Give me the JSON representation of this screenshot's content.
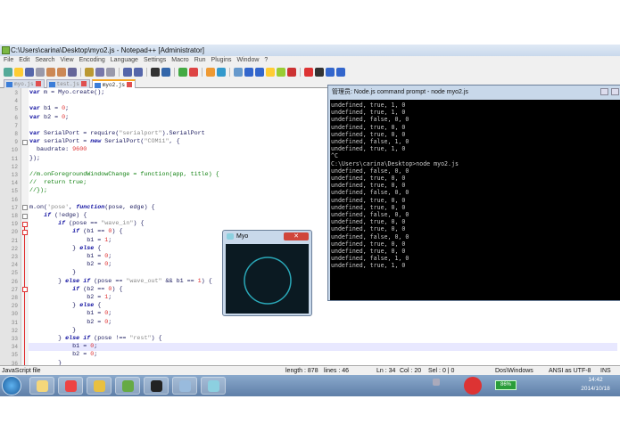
{
  "window_title": "C:\\Users\\carina\\Desktop\\myo2.js - Notepad++ [Administrator]",
  "menu": [
    "File",
    "Edit",
    "Search",
    "View",
    "Encoding",
    "Language",
    "Settings",
    "Macro",
    "Run",
    "Plugins",
    "Window",
    "?"
  ],
  "tabs": [
    {
      "label": "myo.js"
    },
    {
      "label": "test.js"
    },
    {
      "label": "myo2.js",
      "active": true
    }
  ],
  "editor": {
    "first_line": 3,
    "current_line": 34,
    "lines": [
      [
        [
          "kb",
          "var"
        ],
        [
          "t",
          " m = Myo.create();"
        ]
      ],
      [],
      [
        [
          "kb",
          "var"
        ],
        [
          "t",
          " b1 = "
        ],
        [
          "n",
          "0"
        ],
        [
          "t",
          ";"
        ]
      ],
      [
        [
          "kb",
          "var"
        ],
        [
          "t",
          " b2 = "
        ],
        [
          "n",
          "0"
        ],
        [
          "t",
          ";"
        ]
      ],
      [],
      [
        [
          "kb",
          "var"
        ],
        [
          "t",
          " SerialPort = require("
        ],
        [
          "s",
          "\"serialport\""
        ],
        [
          "t",
          ").SerialPort"
        ]
      ],
      [
        [
          "kb",
          "var"
        ],
        [
          "t",
          " serialPort = "
        ],
        [
          "k",
          "new"
        ],
        [
          "t",
          " SerialPort("
        ],
        [
          "s",
          "\"COM11\""
        ],
        [
          "t",
          ", {"
        ]
      ],
      [
        [
          "t",
          "  baudrate: "
        ],
        [
          "n",
          "9600"
        ]
      ],
      [
        [
          "t",
          "});"
        ]
      ],
      [],
      [
        [
          "c",
          "//m.onForegroundWindowChange = function(app, title) {"
        ]
      ],
      [
        [
          "c",
          "//  return true;"
        ]
      ],
      [
        [
          "c",
          "//});"
        ]
      ],
      [],
      [
        [
          "t",
          "m.on("
        ],
        [
          "s",
          "'pose'"
        ],
        [
          "t",
          ", "
        ],
        [
          "k",
          "function"
        ],
        [
          "t",
          "(pose, edge) {"
        ]
      ],
      [
        [
          "t",
          "    "
        ],
        [
          "k",
          "if"
        ],
        [
          "t",
          " (!edge) {"
        ]
      ],
      [
        [
          "t",
          "        "
        ],
        [
          "k",
          "if"
        ],
        [
          "t",
          " (pose == "
        ],
        [
          "s",
          "\"wave_in\""
        ],
        [
          "t",
          ") {"
        ]
      ],
      [
        [
          "t",
          "            "
        ],
        [
          "k",
          "if"
        ],
        [
          "t",
          " (b1 == "
        ],
        [
          "n",
          "0"
        ],
        [
          "t",
          ") {"
        ]
      ],
      [
        [
          "t",
          "                b1 = "
        ],
        [
          "n",
          "1"
        ],
        [
          "t",
          ";"
        ]
      ],
      [
        [
          "t",
          "            } "
        ],
        [
          "k",
          "else"
        ],
        [
          "t",
          " {"
        ]
      ],
      [
        [
          "t",
          "                b1 = "
        ],
        [
          "n",
          "0"
        ],
        [
          "t",
          ";"
        ]
      ],
      [
        [
          "t",
          "                b2 = "
        ],
        [
          "n",
          "0"
        ],
        [
          "t",
          ";"
        ]
      ],
      [
        [
          "t",
          "            }"
        ]
      ],
      [
        [
          "t",
          "        } "
        ],
        [
          "k",
          "else if"
        ],
        [
          "t",
          " (pose == "
        ],
        [
          "s",
          "\"wave_out\""
        ],
        [
          "t",
          " && b1 == "
        ],
        [
          "n",
          "1"
        ],
        [
          "t",
          ") {"
        ]
      ],
      [
        [
          "t",
          "            "
        ],
        [
          "k",
          "if"
        ],
        [
          "t",
          " (b2 == "
        ],
        [
          "n",
          "0"
        ],
        [
          "t",
          ") {"
        ]
      ],
      [
        [
          "t",
          "                b2 = "
        ],
        [
          "n",
          "1"
        ],
        [
          "t",
          ";"
        ]
      ],
      [
        [
          "t",
          "            } "
        ],
        [
          "k",
          "else"
        ],
        [
          "t",
          " {"
        ]
      ],
      [
        [
          "t",
          "                b1 = "
        ],
        [
          "n",
          "0"
        ],
        [
          "t",
          ";"
        ]
      ],
      [
        [
          "t",
          "                b2 = "
        ],
        [
          "n",
          "0"
        ],
        [
          "t",
          ";"
        ]
      ],
      [
        [
          "t",
          "            }"
        ]
      ],
      [
        [
          "t",
          "        } "
        ],
        [
          "k",
          "else if"
        ],
        [
          "t",
          " (pose !== "
        ],
        [
          "s",
          "\"rest\""
        ],
        [
          "t",
          ") {"
        ]
      ],
      [
        [
          "t",
          "            b1 = "
        ],
        [
          "n",
          "0"
        ],
        [
          "t",
          ";"
        ]
      ],
      [
        [
          "t",
          "            b2 = "
        ],
        [
          "n",
          "0"
        ],
        [
          "t",
          ";"
        ]
      ],
      [
        [
          "t",
          "        }"
        ]
      ]
    ]
  },
  "status": {
    "file_type": "JavaScript file",
    "length": "length : 878",
    "lines": "lines : 46",
    "ln": "Ln : 34",
    "col": "Col : 20",
    "sel": "Sel : 0 | 0",
    "eol": "Dos\\Windows",
    "encoding": "ANSI as UTF-8",
    "mode": "INS"
  },
  "console": {
    "title": "管理员: Node.js command prompt - node  myo2.js",
    "lines": [
      "undefined, true, 1, 0",
      "undefined, true, 1, 0",
      "undefined, false, 0, 0",
      "undefined, true, 0, 0",
      "undefined, true, 0, 0",
      "undefined, false, 1, 0",
      "undefined, true, 1, 0",
      "^C",
      "C:\\Users\\carina\\Desktop>node myo2.js",
      "undefined, false, 0, 0",
      "undefined, true, 0, 0",
      "undefined, true, 0, 0",
      "undefined, false, 0, 0",
      "undefined, true, 0, 0",
      "undefined, true, 0, 0",
      "undefined, false, 0, 0",
      "undefined, true, 0, 0",
      "undefined, true, 0, 0",
      "undefined, false, 0, 0",
      "undefined, true, 0, 0",
      "undefined, true, 0, 0",
      "undefined, false, 1, 0",
      "undefined, true, 1, 0"
    ]
  },
  "myo_window": {
    "title": "Myo",
    "ring_color": "#2aa8b8"
  },
  "taskbar": {
    "apps": [
      "explorer-icon",
      "chrome-icon",
      "folder-tools-icon",
      "notepadpp-icon",
      "cmd-icon",
      "paint-icon",
      "myo-icon"
    ],
    "battery": "86%",
    "time": "14:42",
    "date": "2014/10/18"
  }
}
